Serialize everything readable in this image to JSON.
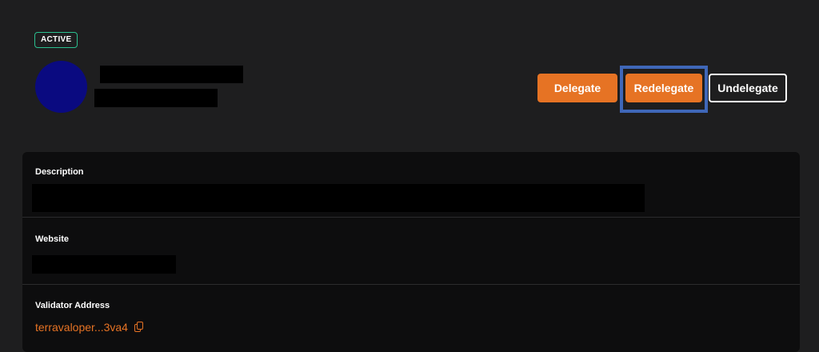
{
  "validator": {
    "status": "ACTIVE",
    "avatar_color": "#0a0a80"
  },
  "actions": {
    "delegate": "Delegate",
    "redelegate": "Redelegate",
    "undelegate": "Undelegate"
  },
  "details": {
    "description_label": "Description",
    "website_label": "Website",
    "address_label": "Validator Address",
    "address_value": "terravaloper...3va4"
  },
  "colors": {
    "accent": "#e67324",
    "status": "#2bbf8f",
    "highlight": "#3f67b8",
    "background": "#1e1e1f",
    "card": "#0d0d0e"
  }
}
